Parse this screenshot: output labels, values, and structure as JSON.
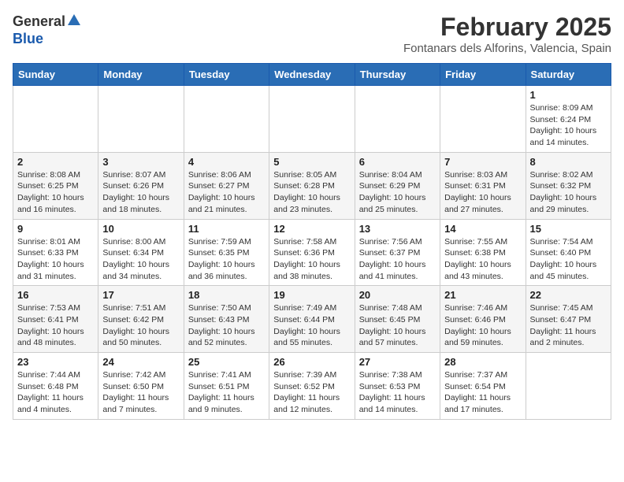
{
  "header": {
    "logo_general": "General",
    "logo_blue": "Blue",
    "title": "February 2025",
    "subtitle": "Fontanars dels Alforins, Valencia, Spain"
  },
  "weekdays": [
    "Sunday",
    "Monday",
    "Tuesday",
    "Wednesday",
    "Thursday",
    "Friday",
    "Saturday"
  ],
  "weeks": [
    [
      {
        "day": "",
        "info": ""
      },
      {
        "day": "",
        "info": ""
      },
      {
        "day": "",
        "info": ""
      },
      {
        "day": "",
        "info": ""
      },
      {
        "day": "",
        "info": ""
      },
      {
        "day": "",
        "info": ""
      },
      {
        "day": "1",
        "info": "Sunrise: 8:09 AM\nSunset: 6:24 PM\nDaylight: 10 hours\nand 14 minutes."
      }
    ],
    [
      {
        "day": "2",
        "info": "Sunrise: 8:08 AM\nSunset: 6:25 PM\nDaylight: 10 hours\nand 16 minutes."
      },
      {
        "day": "3",
        "info": "Sunrise: 8:07 AM\nSunset: 6:26 PM\nDaylight: 10 hours\nand 18 minutes."
      },
      {
        "day": "4",
        "info": "Sunrise: 8:06 AM\nSunset: 6:27 PM\nDaylight: 10 hours\nand 21 minutes."
      },
      {
        "day": "5",
        "info": "Sunrise: 8:05 AM\nSunset: 6:28 PM\nDaylight: 10 hours\nand 23 minutes."
      },
      {
        "day": "6",
        "info": "Sunrise: 8:04 AM\nSunset: 6:29 PM\nDaylight: 10 hours\nand 25 minutes."
      },
      {
        "day": "7",
        "info": "Sunrise: 8:03 AM\nSunset: 6:31 PM\nDaylight: 10 hours\nand 27 minutes."
      },
      {
        "day": "8",
        "info": "Sunrise: 8:02 AM\nSunset: 6:32 PM\nDaylight: 10 hours\nand 29 minutes."
      }
    ],
    [
      {
        "day": "9",
        "info": "Sunrise: 8:01 AM\nSunset: 6:33 PM\nDaylight: 10 hours\nand 31 minutes."
      },
      {
        "day": "10",
        "info": "Sunrise: 8:00 AM\nSunset: 6:34 PM\nDaylight: 10 hours\nand 34 minutes."
      },
      {
        "day": "11",
        "info": "Sunrise: 7:59 AM\nSunset: 6:35 PM\nDaylight: 10 hours\nand 36 minutes."
      },
      {
        "day": "12",
        "info": "Sunrise: 7:58 AM\nSunset: 6:36 PM\nDaylight: 10 hours\nand 38 minutes."
      },
      {
        "day": "13",
        "info": "Sunrise: 7:56 AM\nSunset: 6:37 PM\nDaylight: 10 hours\nand 41 minutes."
      },
      {
        "day": "14",
        "info": "Sunrise: 7:55 AM\nSunset: 6:38 PM\nDaylight: 10 hours\nand 43 minutes."
      },
      {
        "day": "15",
        "info": "Sunrise: 7:54 AM\nSunset: 6:40 PM\nDaylight: 10 hours\nand 45 minutes."
      }
    ],
    [
      {
        "day": "16",
        "info": "Sunrise: 7:53 AM\nSunset: 6:41 PM\nDaylight: 10 hours\nand 48 minutes."
      },
      {
        "day": "17",
        "info": "Sunrise: 7:51 AM\nSunset: 6:42 PM\nDaylight: 10 hours\nand 50 minutes."
      },
      {
        "day": "18",
        "info": "Sunrise: 7:50 AM\nSunset: 6:43 PM\nDaylight: 10 hours\nand 52 minutes."
      },
      {
        "day": "19",
        "info": "Sunrise: 7:49 AM\nSunset: 6:44 PM\nDaylight: 10 hours\nand 55 minutes."
      },
      {
        "day": "20",
        "info": "Sunrise: 7:48 AM\nSunset: 6:45 PM\nDaylight: 10 hours\nand 57 minutes."
      },
      {
        "day": "21",
        "info": "Sunrise: 7:46 AM\nSunset: 6:46 PM\nDaylight: 10 hours\nand 59 minutes."
      },
      {
        "day": "22",
        "info": "Sunrise: 7:45 AM\nSunset: 6:47 PM\nDaylight: 11 hours\nand 2 minutes."
      }
    ],
    [
      {
        "day": "23",
        "info": "Sunrise: 7:44 AM\nSunset: 6:48 PM\nDaylight: 11 hours\nand 4 minutes."
      },
      {
        "day": "24",
        "info": "Sunrise: 7:42 AM\nSunset: 6:50 PM\nDaylight: 11 hours\nand 7 minutes."
      },
      {
        "day": "25",
        "info": "Sunrise: 7:41 AM\nSunset: 6:51 PM\nDaylight: 11 hours\nand 9 minutes."
      },
      {
        "day": "26",
        "info": "Sunrise: 7:39 AM\nSunset: 6:52 PM\nDaylight: 11 hours\nand 12 minutes."
      },
      {
        "day": "27",
        "info": "Sunrise: 7:38 AM\nSunset: 6:53 PM\nDaylight: 11 hours\nand 14 minutes."
      },
      {
        "day": "28",
        "info": "Sunrise: 7:37 AM\nSunset: 6:54 PM\nDaylight: 11 hours\nand 17 minutes."
      },
      {
        "day": "",
        "info": ""
      }
    ]
  ]
}
